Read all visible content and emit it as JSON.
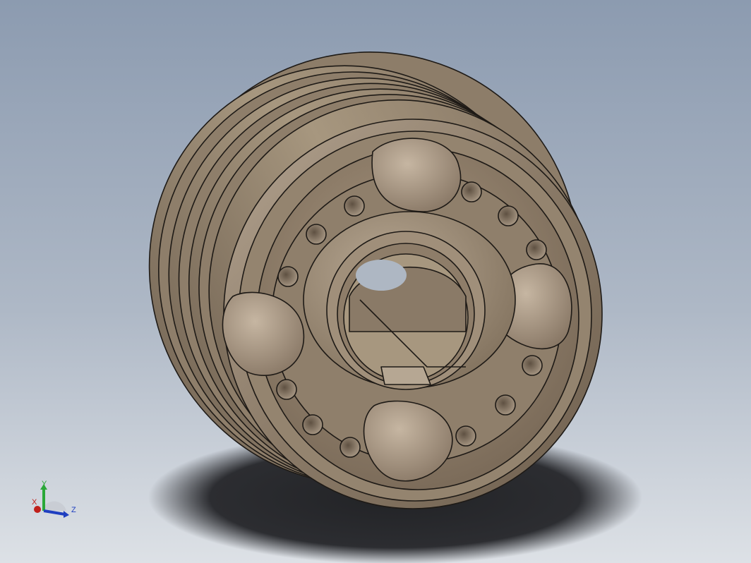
{
  "viewport": {
    "background_top": "#8d9cb0",
    "background_bottom": "#d9dee4",
    "shadow_color": "#2a2b2e"
  },
  "part": {
    "name": "pulley",
    "material_color": "#9a8a77",
    "edge_color": "#1e1a16"
  },
  "triad": {
    "x_label": "X",
    "y_label": "Y",
    "z_label": "Z",
    "x_color": "#c0201a",
    "y_color": "#2aa838",
    "z_color": "#1f3fc0"
  }
}
